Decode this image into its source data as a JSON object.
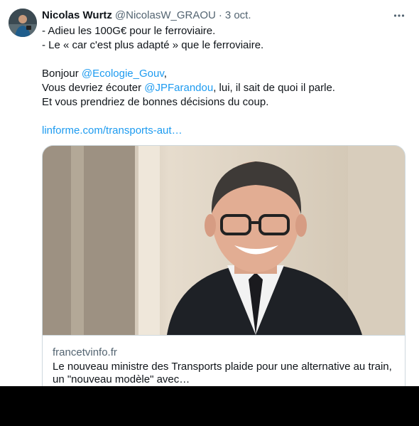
{
  "author": {
    "name": "Nicolas Wurtz",
    "handle": "@NicolasW_GRAOU",
    "separator": "·",
    "date": "3 oct."
  },
  "more_label": "···",
  "tweet": {
    "line1": "- Adieu les 100G€ pour le ferroviaire.",
    "line2": "- Le « car c'est plus adapté » que le ferroviaire.",
    "greeting": "Bonjour ",
    "mention1": "@Ecologie_Gouv",
    "greeting_end": ",",
    "line5_start": "Vous devriez écouter ",
    "mention2": "@JPFarandou",
    "line5_end": ", lui, il sait de quoi il parle.",
    "line6": "Et vous prendriez de bonnes décisions du coup.",
    "link": "linforme.com/transports-aut…"
  },
  "card": {
    "domain": "francetvinfo.fr",
    "title": "Le nouveau ministre des Transports plaide pour une alternative au train, un \"nouveau modèle\" avec…"
  },
  "colors": {
    "link": "#1d9bf0",
    "text": "#0f1419",
    "secondary": "#536471",
    "border": "#cfd9de"
  },
  "icons": {
    "more": "more-horizontal-icon"
  }
}
